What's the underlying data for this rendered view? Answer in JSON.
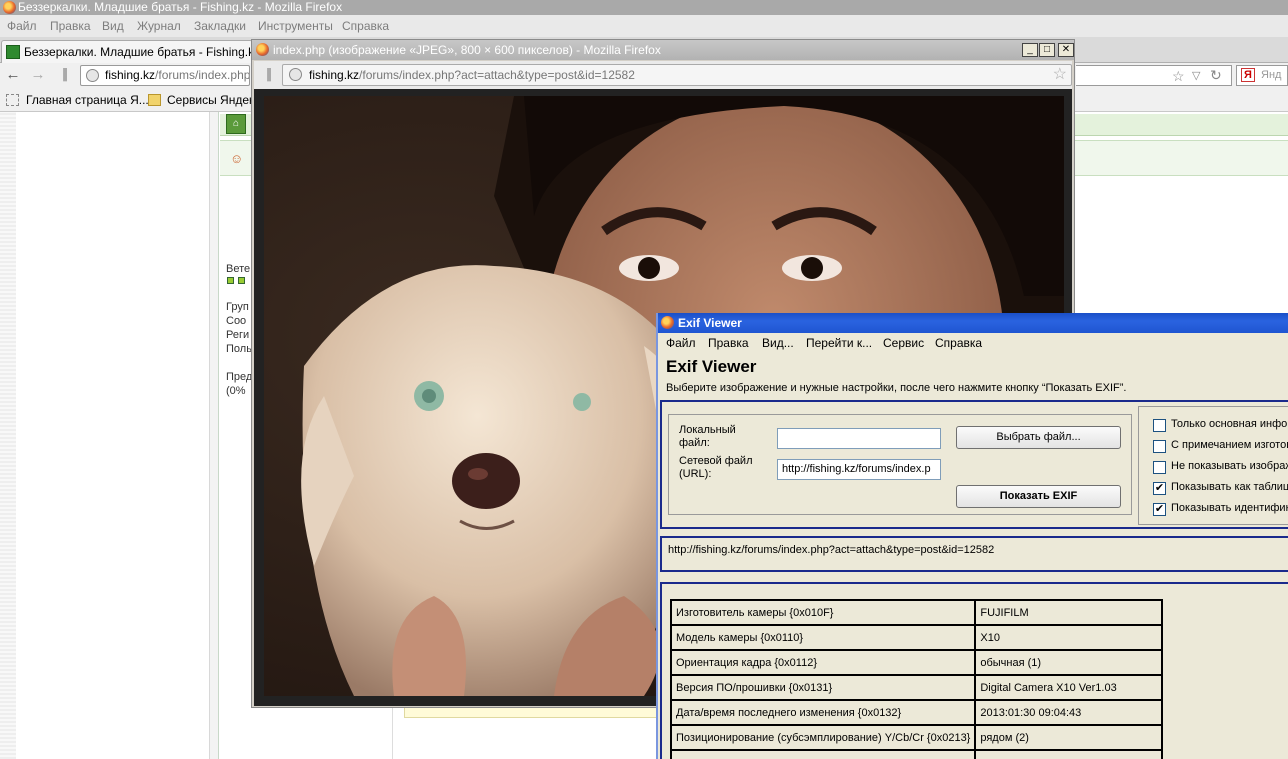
{
  "main_window": {
    "title": "Беззеркалки. Младшие братья - Fishing.kz - Mozilla Firefox",
    "menu": [
      "Файл",
      "Правка",
      "Вид",
      "Журнал",
      "Закладки",
      "Инструменты",
      "Справка"
    ],
    "tab_title": "Беззеркалки. Младшие братья - Fishing.kz",
    "url_domain": "fishing.kz",
    "url_path": "/forums/index.php?s",
    "search_engine_text": "Янд",
    "bookmarks": [
      "Главная страница Я...",
      "Сервисы Яндекс"
    ]
  },
  "page_behind": {
    "labels": [
      "Вете",
      "Груп",
      "Соо",
      "Реги",
      "Поль",
      "Пред",
      "(0%"
    ]
  },
  "image_window": {
    "title": "index.php (изображение «JPEG», 800 × 600 пикселов) - Mozilla Firefox",
    "url_domain": "fishing.kz",
    "url_path": "/forums/index.php?act=attach&type=post&id=12582",
    "btn_minimize": "_",
    "btn_maximize": "□",
    "btn_close": "✕",
    "image_width": 800,
    "image_height": 600
  },
  "exif_viewer": {
    "title": "Exif Viewer",
    "menu": [
      "Файл",
      "Правка",
      "Вид...",
      "Перейти к...",
      "Сервис",
      "Справка"
    ],
    "heading": "Exif Viewer",
    "instructions": "Выберите изображение и нужные настройки, после чего нажмите кнопку “Показать EXIF”.",
    "local_file_label_1": "Локальный",
    "local_file_label_2": "файл:",
    "local_file_value": "",
    "network_file_label_1": "Сетевой файл",
    "network_file_label_2": "(URL):",
    "network_file_value": "http://fishing.kz/forums/index.p",
    "choose_file_button": "Выбрать файл...",
    "show_exif_button": "Показать EXIF",
    "options": [
      {
        "label": "Только основная инфор",
        "checked": false
      },
      {
        "label": "С примечанием изготови",
        "checked": false
      },
      {
        "label": "Не показывать изображ",
        "checked": false
      },
      {
        "label": "Показывать как таблиц",
        "checked": true
      },
      {
        "label": "Показывать идентифик",
        "checked": true
      }
    ],
    "current_url": "http://fishing.kz/forums/index.php?act=attach&type=post&id=12582",
    "rows": [
      {
        "key": "Изготовитель камеры {0x010F}",
        "value": "FUJIFILM"
      },
      {
        "key": "Модель камеры {0x0110}",
        "value": "X10"
      },
      {
        "key": "Ориентация кадра {0x0112}",
        "value": "обычная (1)"
      },
      {
        "key": "Версия ПО/прошивки {0x0131}",
        "value": "Digital Camera X10 Ver1.03"
      },
      {
        "key": "Дата/время последнего изменения {0x0132}",
        "value": "2013:01:30 09:04:43"
      },
      {
        "key": "Позиционирование (субсэмплирование) Y/Cb/Cr {0x0213}",
        "value": "рядом (2)"
      },
      {
        "key": "",
        "value": ""
      }
    ]
  },
  "colors": {
    "exif_titlebar": "#2a63e0",
    "exif_border": "#1a2a8c",
    "inactive_titlebar": "#b2b2b2"
  }
}
